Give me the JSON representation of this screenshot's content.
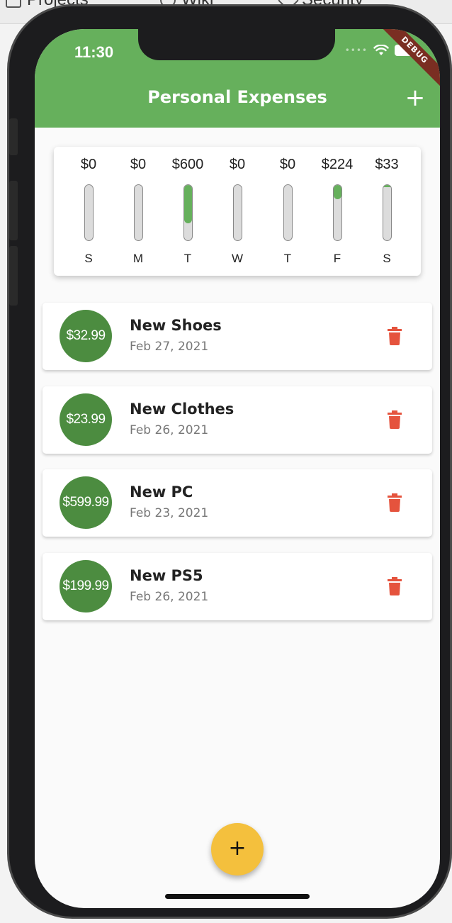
{
  "browser": {
    "tabs": [
      "Projects",
      "Wiki",
      "Security"
    ]
  },
  "status_bar": {
    "time": "11:30",
    "debug_banner": "DEBUG"
  },
  "app_bar": {
    "title": "Personal Expenses",
    "add_icon": "plus-icon",
    "add_label": "+"
  },
  "colors": {
    "primary": "#66b05c",
    "amount_circle": "#4c8c40",
    "accent": "#f4c03d",
    "delete": "#e5533d"
  },
  "chart": {
    "days": [
      {
        "amount": "$0",
        "day": "S",
        "fraction": 0
      },
      {
        "amount": "$0",
        "day": "M",
        "fraction": 0
      },
      {
        "amount": "$600",
        "day": "T",
        "fraction": 0.69
      },
      {
        "amount": "$0",
        "day": "W",
        "fraction": 0
      },
      {
        "amount": "$0",
        "day": "T",
        "fraction": 0
      },
      {
        "amount": "$224",
        "day": "F",
        "fraction": 0.26
      },
      {
        "amount": "$33",
        "day": "S",
        "fraction": 0.04
      }
    ]
  },
  "transactions": [
    {
      "amount": "$32.99",
      "title": "New Shoes",
      "date": "Feb 27, 2021",
      "delete_icon": "trash-icon"
    },
    {
      "amount": "$23.99",
      "title": "New Clothes",
      "date": "Feb 26, 2021",
      "delete_icon": "trash-icon"
    },
    {
      "amount": "$599.99",
      "title": "New PC",
      "date": "Feb 23, 2021",
      "delete_icon": "trash-icon"
    },
    {
      "amount": "$199.99",
      "title": "New PS5",
      "date": "Feb 26, 2021",
      "delete_icon": "trash-icon"
    }
  ],
  "fab": {
    "icon": "plus-icon",
    "label": "+"
  }
}
